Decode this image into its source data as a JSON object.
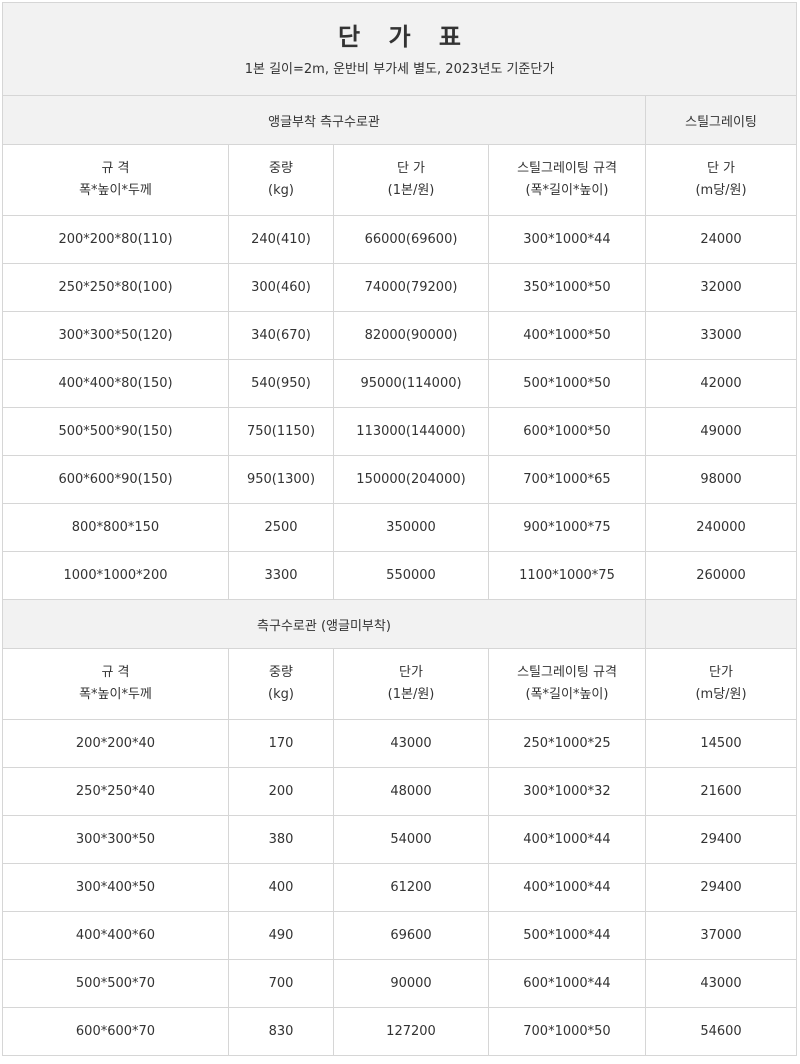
{
  "title": "단 가 표",
  "subtitle": "1본 길이=2m, 운반비 부가세 별도, 2023년도 기준단가",
  "sections": [
    {
      "name": "앵글부착 측구수로관",
      "grating_name": "스틸그레이팅",
      "headers": [
        {
          "l1": "규 격",
          "l2": "폭*높이*두께"
        },
        {
          "l1": "중량",
          "l2": "(kg)"
        },
        {
          "l1": "단 가",
          "l2": "(1본/원)"
        },
        {
          "l1": "스틸그레이팅 규격",
          "l2": "(폭*길이*높이)"
        },
        {
          "l1": "단 가",
          "l2": "(m당/원)"
        }
      ],
      "rows": [
        [
          "200*200*80(110)",
          "240(410)",
          "66000(69600)",
          "300*1000*44",
          "24000"
        ],
        [
          "250*250*80(100)",
          "300(460)",
          "74000(79200)",
          "350*1000*50",
          "32000"
        ],
        [
          "300*300*50(120)",
          "340(670)",
          "82000(90000)",
          "400*1000*50",
          "33000"
        ],
        [
          "400*400*80(150)",
          "540(950)",
          "95000(114000)",
          "500*1000*50",
          "42000"
        ],
        [
          "500*500*90(150)",
          "750(1150)",
          "113000(144000)",
          "600*1000*50",
          "49000"
        ],
        [
          "600*600*90(150)",
          "950(1300)",
          "150000(204000)",
          "700*1000*65",
          "98000"
        ],
        [
          "800*800*150",
          "2500",
          "350000",
          "900*1000*75",
          "240000"
        ],
        [
          "1000*1000*200",
          "3300",
          "550000",
          "1100*1000*75",
          "260000"
        ]
      ]
    },
    {
      "name": "측구수로관 (앵글미부착)",
      "grating_name": "",
      "headers": [
        {
          "l1": "규 격",
          "l2": "폭*높이*두께"
        },
        {
          "l1": "중량",
          "l2": "(kg)"
        },
        {
          "l1": "단가",
          "l2": "(1본/원)"
        },
        {
          "l1": "스틸그레이팅 규격",
          "l2": "(폭*길이*높이)"
        },
        {
          "l1": "단가",
          "l2": "(m당/원)"
        }
      ],
      "rows": [
        [
          "200*200*40",
          "170",
          "43000",
          "250*1000*25",
          "14500"
        ],
        [
          "250*250*40",
          "200",
          "48000",
          "300*1000*32",
          "21600"
        ],
        [
          "300*300*50",
          "380",
          "54000",
          "400*1000*44",
          "29400"
        ],
        [
          "300*400*50",
          "400",
          "61200",
          "400*1000*44",
          "29400"
        ],
        [
          "400*400*60",
          "490",
          "69600",
          "500*1000*44",
          "37000"
        ],
        [
          "500*500*70",
          "700",
          "90000",
          "600*1000*44",
          "43000"
        ],
        [
          "600*600*70",
          "830",
          "127200",
          "700*1000*50",
          "54600"
        ]
      ]
    }
  ],
  "colors": {
    "header_bg": "#f2f2f2",
    "border": "#d6d6d6",
    "text": "#333333"
  }
}
